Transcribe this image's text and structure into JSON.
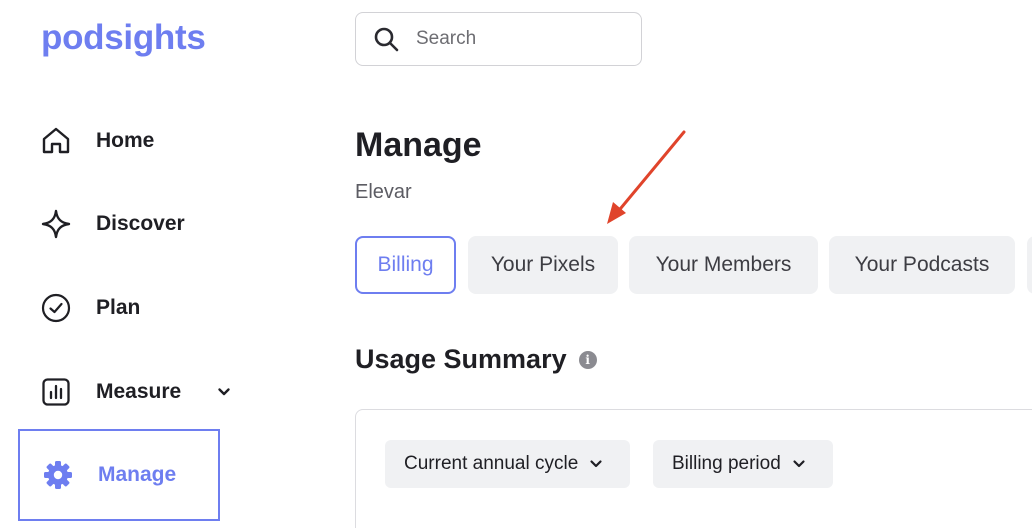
{
  "brand": {
    "logo_text": "podsights",
    "accent_color": "#6e7ef0"
  },
  "sidebar": {
    "items": [
      {
        "label": "Home",
        "icon": "home-icon"
      },
      {
        "label": "Discover",
        "icon": "sparkle-icon"
      },
      {
        "label": "Plan",
        "icon": "check-circle-icon"
      },
      {
        "label": "Measure",
        "icon": "bar-chart-icon",
        "has_submenu": true
      },
      {
        "label": "Manage",
        "icon": "gear-icon",
        "active": true
      }
    ]
  },
  "search": {
    "placeholder": "Search",
    "icon": "search-icon"
  },
  "main": {
    "title": "Manage",
    "org_name": "Elevar",
    "tabs": [
      {
        "label": "Billing",
        "active": true
      },
      {
        "label": "Your Pixels"
      },
      {
        "label": "Your Members"
      },
      {
        "label": "Your Podcasts"
      }
    ],
    "annotation": {
      "type": "red-arrow",
      "points_to": "Your Pixels",
      "color": "#e0442b"
    },
    "usage_summary": {
      "title": "Usage Summary",
      "filters": [
        {
          "label": "Current annual cycle"
        },
        {
          "label": "Billing period"
        }
      ]
    }
  }
}
